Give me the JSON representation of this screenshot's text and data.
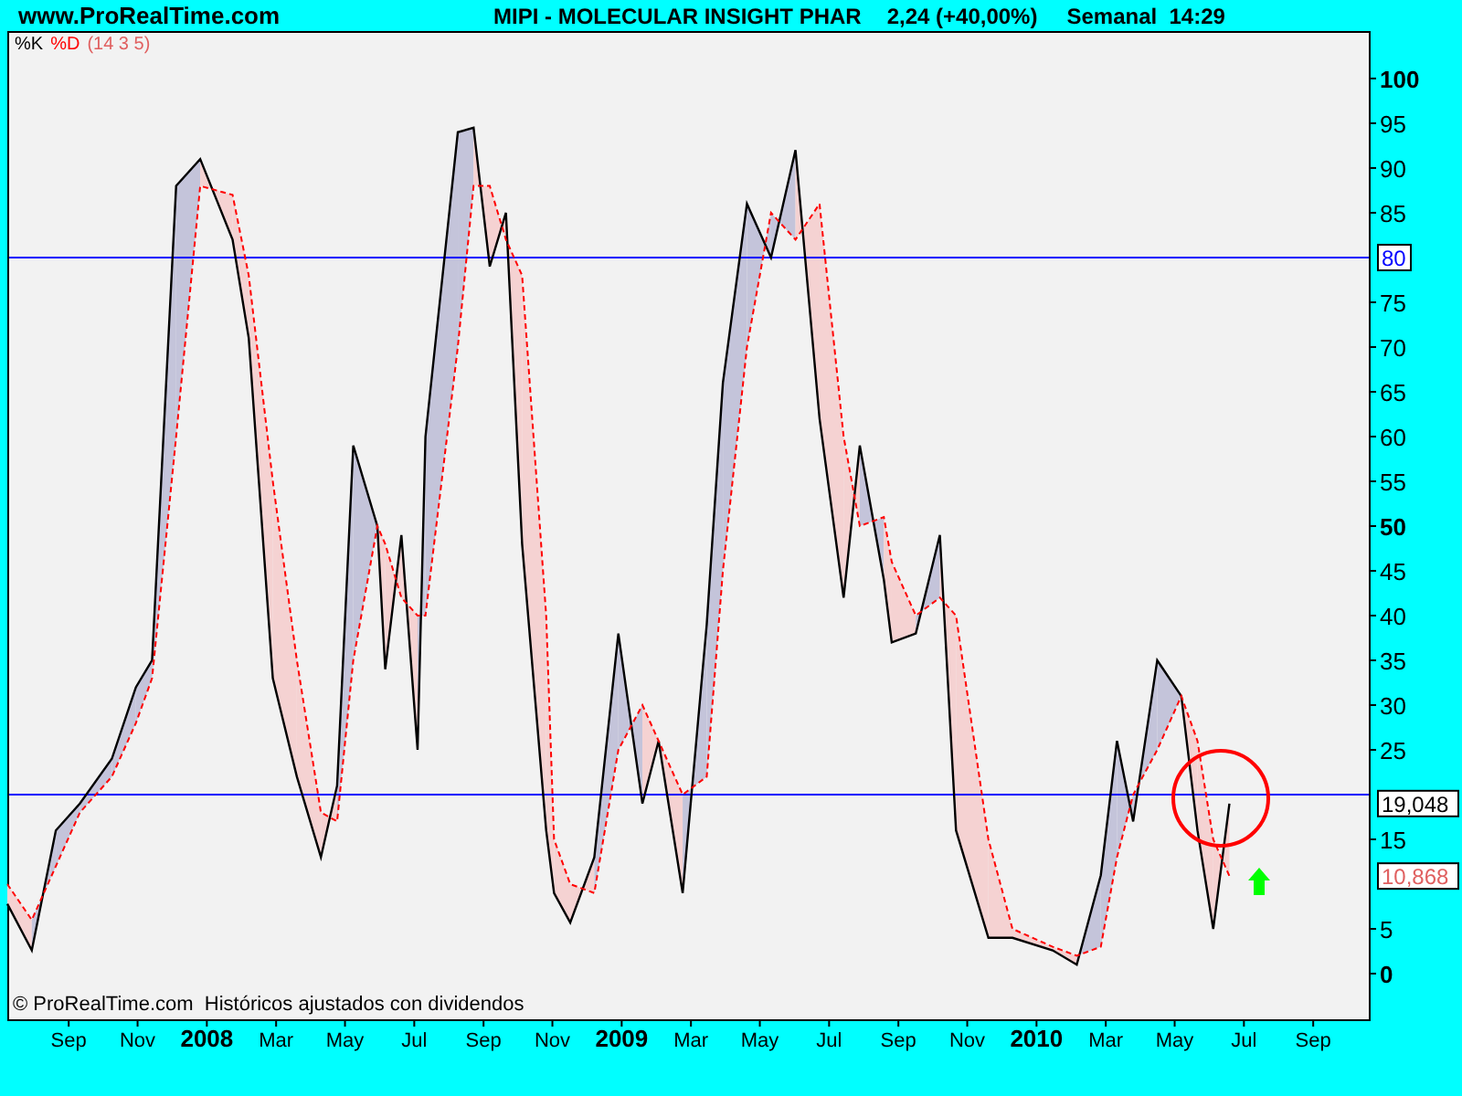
{
  "header": {
    "site": "www.ProRealTime.com",
    "title": "MIPI - MOLECULAR INSIGHT PHAR",
    "price": "2,24 (+40,00%)",
    "period": "Semanal  14:29"
  },
  "legend_params": "(14 3 5)",
  "footer_note": "© ProRealTime.com  Históricos ajustados con dividendos",
  "last_values": [
    {
      "text": "19,048",
      "color": "#000000"
    },
    {
      "text": "10,868",
      "color": "#e06060"
    }
  ],
  "chart_data": {
    "type": "line",
    "x": [
      2007.519,
      2007.578,
      2007.636,
      2007.694,
      2007.771,
      2007.829,
      2007.868,
      2007.926,
      2007.984,
      2008.062,
      2008.101,
      2008.159,
      2008.217,
      2008.275,
      2008.314,
      2008.353,
      2008.411,
      2008.43,
      2008.469,
      2008.508,
      2008.527,
      2008.605,
      2008.643,
      2008.682,
      2008.721,
      2008.76,
      2008.818,
      2008.837,
      2008.876,
      2008.934,
      2008.992,
      2009.05,
      2009.089,
      2009.147,
      2009.205,
      2009.244,
      2009.302,
      2009.36,
      2009.419,
      2009.477,
      2009.535,
      2009.574,
      2009.632,
      2009.651,
      2009.709,
      2009.767,
      2009.806,
      2009.884,
      2009.942,
      2010.039,
      2010.097,
      2010.155,
      2010.194,
      2010.233,
      2010.291,
      2010.349,
      2010.388,
      2010.426,
      2010.465
    ],
    "series": [
      {
        "name": "%K",
        "color": "#000000",
        "line_style": "solid",
        "values": [
          7.8,
          2.6,
          16,
          19,
          24,
          32,
          35,
          88,
          91,
          82,
          71,
          33,
          22,
          13,
          21,
          59,
          50,
          34,
          49,
          25,
          60,
          94,
          94.5,
          79,
          85,
          48,
          16,
          9,
          5.7,
          13,
          38,
          19,
          26,
          9,
          39,
          66,
          86,
          80,
          92,
          62,
          42,
          59,
          44,
          37,
          38,
          49,
          16,
          4,
          4,
          2.6,
          1,
          11,
          26,
          17,
          35,
          31,
          16,
          5,
          19
        ]
      },
      {
        "name": "%D",
        "color": "#ff0000",
        "line_style": "dashed",
        "values": [
          10,
          6,
          12,
          18,
          22,
          28,
          33,
          60,
          88,
          87,
          78,
          55,
          35,
          18,
          17,
          35,
          50,
          48,
          42,
          40,
          40,
          70,
          88,
          88,
          82,
          78,
          40,
          15,
          10,
          9,
          25,
          30,
          26,
          20,
          22,
          45,
          70,
          85,
          82,
          86,
          60,
          50,
          51,
          46,
          40,
          42,
          40,
          15,
          5,
          3,
          2,
          3,
          13,
          20,
          25,
          31,
          26,
          15,
          10.9
        ]
      }
    ],
    "xlim": [
      2007.519,
      2010.801
    ],
    "ylim": [
      -5.1,
      105.3
    ],
    "xticks": [
      {
        "value": 2007.667,
        "label": "Sep"
      },
      {
        "value": 2007.833,
        "label": "Nov"
      },
      {
        "value": 2008,
        "label": "2008"
      },
      {
        "value": 2008.167,
        "label": "Mar"
      },
      {
        "value": 2008.333,
        "label": "May"
      },
      {
        "value": 2008.5,
        "label": "Jul"
      },
      {
        "value": 2008.667,
        "label": "Sep"
      },
      {
        "value": 2008.833,
        "label": "Nov"
      },
      {
        "value": 2009,
        "label": "2009"
      },
      {
        "value": 2009.167,
        "label": "Mar"
      },
      {
        "value": 2009.333,
        "label": "May"
      },
      {
        "value": 2009.5,
        "label": "Jul"
      },
      {
        "value": 2009.667,
        "label": "Sep"
      },
      {
        "value": 2009.833,
        "label": "Nov"
      },
      {
        "value": 2010,
        "label": "2010"
      },
      {
        "value": 2010.167,
        "label": "Mar"
      },
      {
        "value": 2010.333,
        "label": "May"
      },
      {
        "value": 2010.5,
        "label": "Jul"
      },
      {
        "value": 2010.667,
        "label": "Sep"
      }
    ],
    "yticks": [
      100,
      95,
      90,
      85,
      75,
      70,
      65,
      60,
      55,
      50,
      45,
      40,
      35,
      30,
      25,
      15,
      5,
      0
    ],
    "ref_lines": [
      {
        "axis": "y",
        "value": 80,
        "label": "80",
        "color": "#0000ff"
      },
      {
        "axis": "y",
        "value": 20,
        "color": "#0000ff"
      }
    ]
  }
}
